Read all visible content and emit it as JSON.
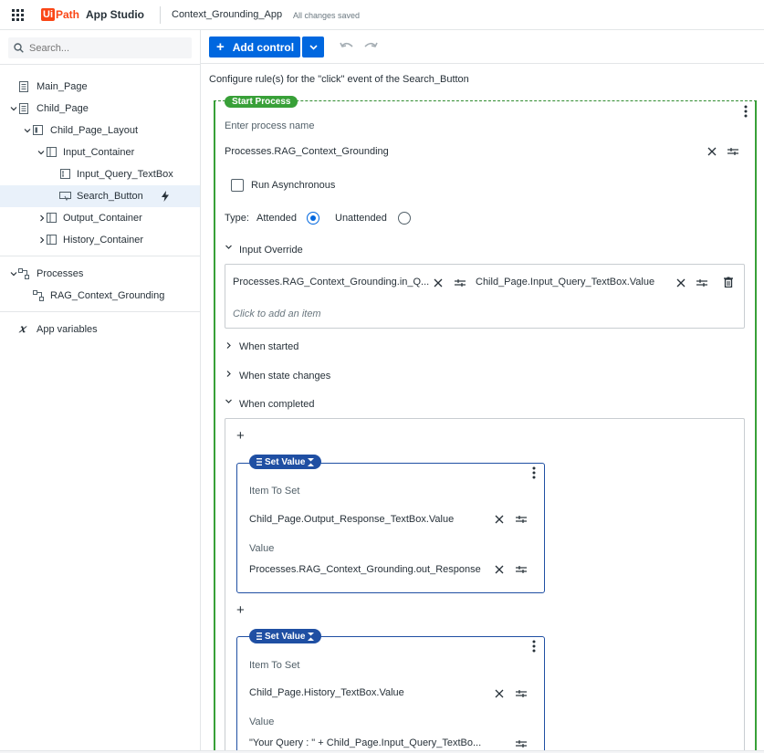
{
  "topbar": {
    "logo_ui": "Ui",
    "logo_path": "Path",
    "product": "App Studio",
    "app_name": "Context_Grounding_App",
    "save_status": "All changes saved"
  },
  "sidebar": {
    "search_placeholder": "Search...",
    "tree": [
      {
        "label": "Main_Page"
      },
      {
        "label": "Child_Page"
      },
      {
        "label": "Child_Page_Layout"
      },
      {
        "label": "Input_Container"
      },
      {
        "label": "Input_Query_TextBox"
      },
      {
        "label": "Search_Button"
      },
      {
        "label": "Output_Container"
      },
      {
        "label": "History_Container"
      }
    ],
    "processes_label": "Processes",
    "process_item": "RAG_Context_Grounding",
    "app_variables": "App variables"
  },
  "toolbar": {
    "add_control": "Add control"
  },
  "rule_title": "Configure rule(s) for the \"click\" event of the Search_Button",
  "start_process": {
    "pill": "Start Process",
    "process_name_label": "Enter process name",
    "process_name_value": "Processes.RAG_Context_Grounding",
    "run_async_label": "Run Asynchronous",
    "type_label": "Type:",
    "attended": "Attended",
    "unattended": "Unattended",
    "input_override_label": "Input Override",
    "input_override_key": "Processes.RAG_Context_Grounding.in_Q...",
    "input_override_value": "Child_Page.Input_Query_TextBox.Value",
    "click_to_add": "Click to add an item",
    "when_started": "When started",
    "when_state_changes": "When state changes",
    "when_completed": "When completed"
  },
  "set_value_1": {
    "pill": "Set Value",
    "item_label": "Item To Set",
    "item_value": "Child_Page.Output_Response_TextBox.Value",
    "value_label": "Value",
    "value_value": "Processes.RAG_Context_Grounding.out_Response"
  },
  "set_value_2": {
    "pill": "Set Value",
    "item_label": "Item To Set",
    "item_value": "Child_Page.History_TextBox.Value",
    "value_label": "Value",
    "value_value": "\"Your Query : \" + Child_Page.Input_Query_TextBo..."
  },
  "colors": {
    "primary": "#0067df",
    "start_green": "#38a038",
    "set_blue": "#1f4fa3",
    "brand_orange": "#fa4616"
  }
}
